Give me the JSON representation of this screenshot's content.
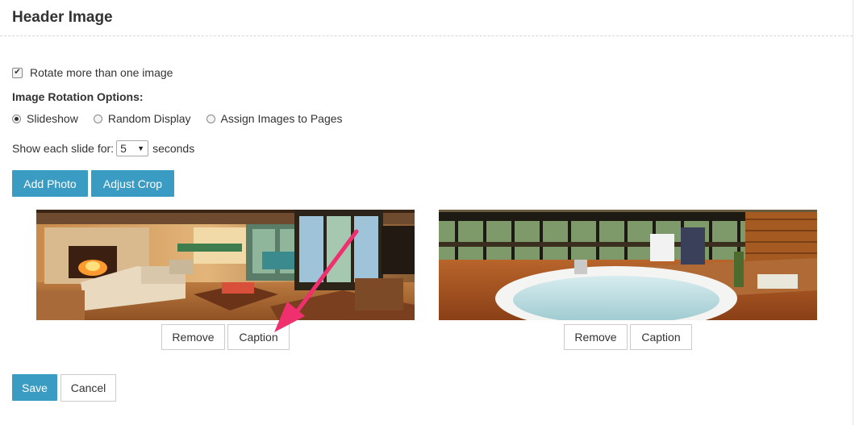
{
  "header": {
    "title": "Header Image"
  },
  "rotate": {
    "label": "Rotate more than one image",
    "checked": true
  },
  "rotation_options": {
    "label": "Image Rotation Options:",
    "options": [
      {
        "label": "Slideshow",
        "selected": true
      },
      {
        "label": "Random Display",
        "selected": false
      },
      {
        "label": "Assign Images to Pages",
        "selected": false
      }
    ]
  },
  "slide_duration": {
    "prefix": "Show each slide for:",
    "value": "5",
    "suffix": "seconds"
  },
  "toolbar": {
    "add_photo": "Add Photo",
    "adjust_crop": "Adjust Crop"
  },
  "images": [
    {
      "description": "living room with fireplace",
      "remove": "Remove",
      "caption": "Caption"
    },
    {
      "description": "bathtub by windows",
      "remove": "Remove",
      "caption": "Caption"
    }
  ],
  "actions": {
    "save": "Save",
    "cancel": "Cancel"
  },
  "colors": {
    "accent": "#3a9bc3",
    "annotation_arrow": "#f0306e"
  }
}
